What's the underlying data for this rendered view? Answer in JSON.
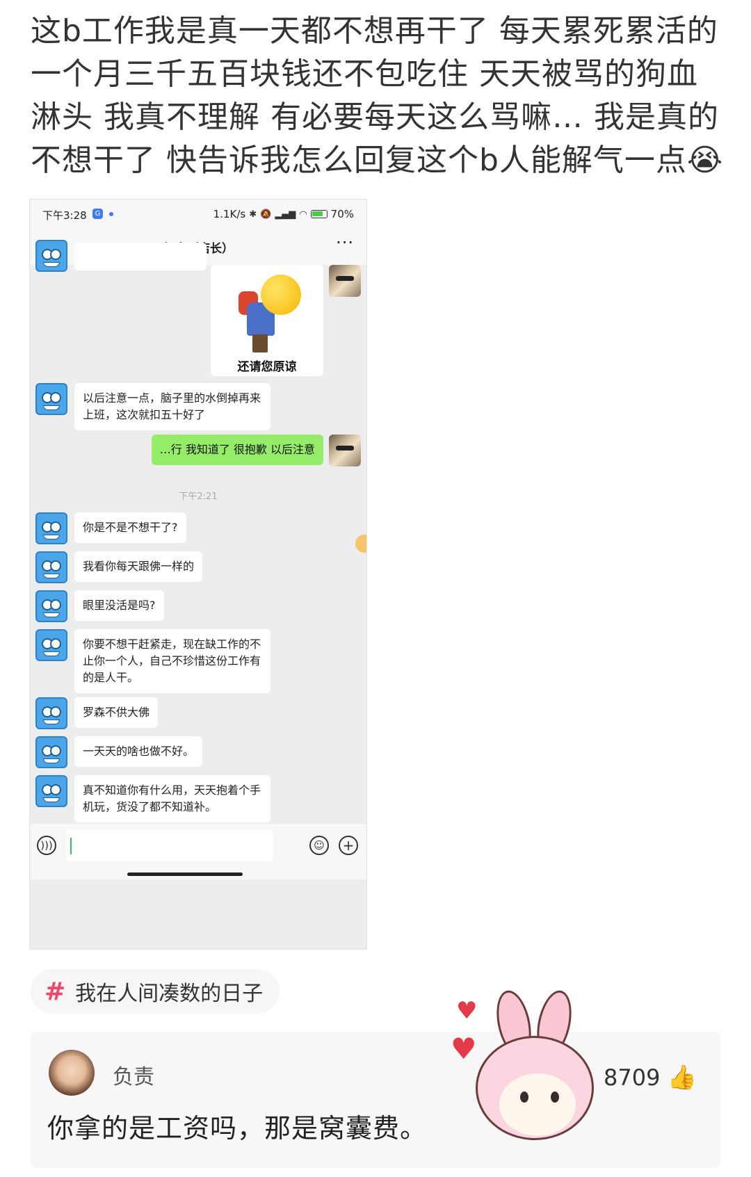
{
  "post": {
    "text": "这b工作我是真一天都不想再干了  每天累死累活的一个月三千五百块钱还不包吃住 天天被骂的狗血淋头 我真不理解 有必要每天这么骂嘛… 我是真的不想干了 快告诉我怎么回复这个b人能解气一点😭"
  },
  "phone": {
    "status": {
      "time": "下午3:28",
      "speed": "1.1K/s",
      "battery": "70%"
    },
    "chat_title": "赵鑫（店长）",
    "sticker_caption": "还请您原谅",
    "messages": [
      {
        "from": "other",
        "text": "以后注意一点，脑子里的水倒掉再来上班，这次就扣五十好了"
      },
      {
        "from": "self",
        "text": "…行 我知道了 很抱歉 以后注意"
      },
      {
        "from": "time",
        "text": "下午2:21"
      },
      {
        "from": "other",
        "text": "你是不是不想干了?"
      },
      {
        "from": "other",
        "text": "我看你每天跟佛一样的"
      },
      {
        "from": "other",
        "text": "眼里没活是吗?"
      },
      {
        "from": "other",
        "text": "你要不想干赶紧走，现在缺工作的不止你一个人，自己不珍惜这份工作有的是人干。"
      },
      {
        "from": "other",
        "text": "罗森不供大佛"
      },
      {
        "from": "other",
        "text": "一天天的啥也做不好。"
      },
      {
        "from": "other",
        "text": "真不知道你有什么用，天天抱着个手机玩，货没了都不知道补。"
      }
    ]
  },
  "topic": {
    "label": "我在人间凑数的日子"
  },
  "comment": {
    "author": "负责",
    "text": "你拿的是工资吗，那是窝囊费。",
    "likes": "8709"
  }
}
